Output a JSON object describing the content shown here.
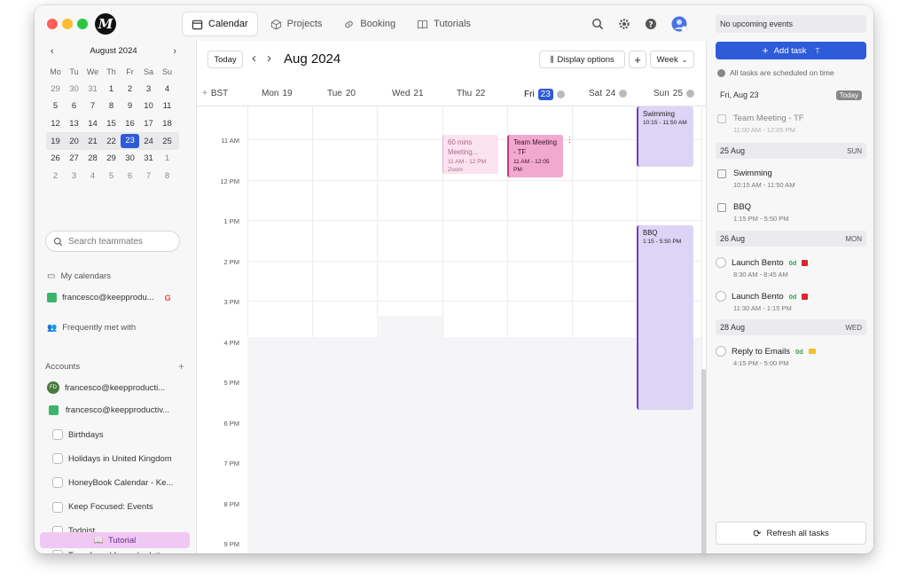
{
  "topnav": {
    "tabs": [
      {
        "label": "Calendar",
        "active": true,
        "icon": "calendar-icon"
      },
      {
        "label": "Projects",
        "icon": "cube-icon"
      },
      {
        "label": "Booking",
        "icon": "link-icon"
      },
      {
        "label": "Tutorials",
        "icon": "book-icon"
      }
    ]
  },
  "mini_calendar": {
    "month": "August 2024",
    "dow": [
      "Mo",
      "Tu",
      "We",
      "Th",
      "Fr",
      "Sa",
      "Su"
    ],
    "weeks": [
      [
        "29",
        "30",
        "31",
        "1",
        "2",
        "3",
        "4"
      ],
      [
        "5",
        "6",
        "7",
        "8",
        "9",
        "10",
        "11"
      ],
      [
        "12",
        "13",
        "14",
        "15",
        "16",
        "17",
        "18"
      ],
      [
        "19",
        "20",
        "21",
        "22",
        "23",
        "24",
        "25"
      ],
      [
        "26",
        "27",
        "28",
        "29",
        "30",
        "31",
        "1"
      ],
      [
        "2",
        "3",
        "4",
        "5",
        "6",
        "7",
        "8"
      ]
    ],
    "selected": "23"
  },
  "sidebar": {
    "search_placeholder": "Search teammates",
    "my_calendars": "My calendars",
    "my_cal_account": "francesco@keepprodu...",
    "frequently": "Frequently met with",
    "accounts": "Accounts",
    "account_items": [
      "francesco@keepproducti...",
      "francesco@keepproductiv..."
    ],
    "calendars": [
      "Birthdays",
      "Holidays in United Kingdom",
      "HoneyBook Calendar - Ke...",
      "Keep Focused: Events",
      "Todoist",
      "Transferred from charlotte..."
    ],
    "tutorial": "Tutorial",
    "avatar_initials": "FD"
  },
  "toolbar": {
    "today": "Today",
    "month_title": "Aug 2024",
    "display_options": "Display options",
    "view": "Week"
  },
  "days": {
    "tz": "BST",
    "items": [
      {
        "dow": "Mon",
        "num": "19"
      },
      {
        "dow": "Tue",
        "num": "20"
      },
      {
        "dow": "Wed",
        "num": "21"
      },
      {
        "dow": "Thu",
        "num": "22"
      },
      {
        "dow": "Fri",
        "num": "23"
      },
      {
        "dow": "Sat",
        "num": "24"
      },
      {
        "dow": "Sun",
        "num": "25"
      }
    ]
  },
  "times": [
    "11 AM",
    "12 PM",
    "1 PM",
    "2 PM",
    "3 PM",
    "4 PM",
    "5 PM",
    "6 PM",
    "7 PM",
    "8 PM",
    "9 PM"
  ],
  "events": {
    "swimming": {
      "title": "Swimming",
      "time": "10:15 - 11:50 AM"
    },
    "meeting": {
      "title": "60 mins Meeting...",
      "time": "11 AM - 12 PM",
      "loc": "Zoom"
    },
    "team": {
      "title": "Team Meeting - TF",
      "time": "11 AM - 12:05 PM"
    },
    "bbq": {
      "title": "BBQ",
      "time": "1:15 - 5:50 PM"
    }
  },
  "right": {
    "no_events": "No upcoming events",
    "add_task": "Add task",
    "add_task_key": "T",
    "scheduled": "All tasks are scheduled on time",
    "groups": [
      {
        "date": "Fri, Aug 23",
        "tag": "Today"
      },
      {
        "date": "25 Aug",
        "tag": "SUN"
      },
      {
        "date": "26 Aug",
        "tag": "MON"
      },
      {
        "date": "28 Aug",
        "tag": "WED"
      }
    ],
    "tasks": [
      {
        "title": "Team Meeting - TF",
        "time": "11:00 AM - 12:05 PM"
      },
      {
        "title": "Swimming",
        "time": "10:15 AM - 11:50 AM"
      },
      {
        "title": "BBQ",
        "time": "1:15 PM - 5:50 PM"
      },
      {
        "title": "Launch Bento",
        "due": "0d",
        "time": "8:30 AM - 8:45 AM"
      },
      {
        "title": "Launch Bento",
        "due": "0d",
        "time": "11:30 AM - 1:15 PM"
      },
      {
        "title": "Reply to Emails",
        "due": "0d",
        "time": "4:15 PM - 5:00 PM"
      }
    ],
    "refresh": "Refresh all tasks"
  },
  "colors": {
    "accent": "#2e5bd8",
    "pink": "#f2a9cf",
    "lavender": "#ddd5f5",
    "purple": "#6b3fc9"
  }
}
